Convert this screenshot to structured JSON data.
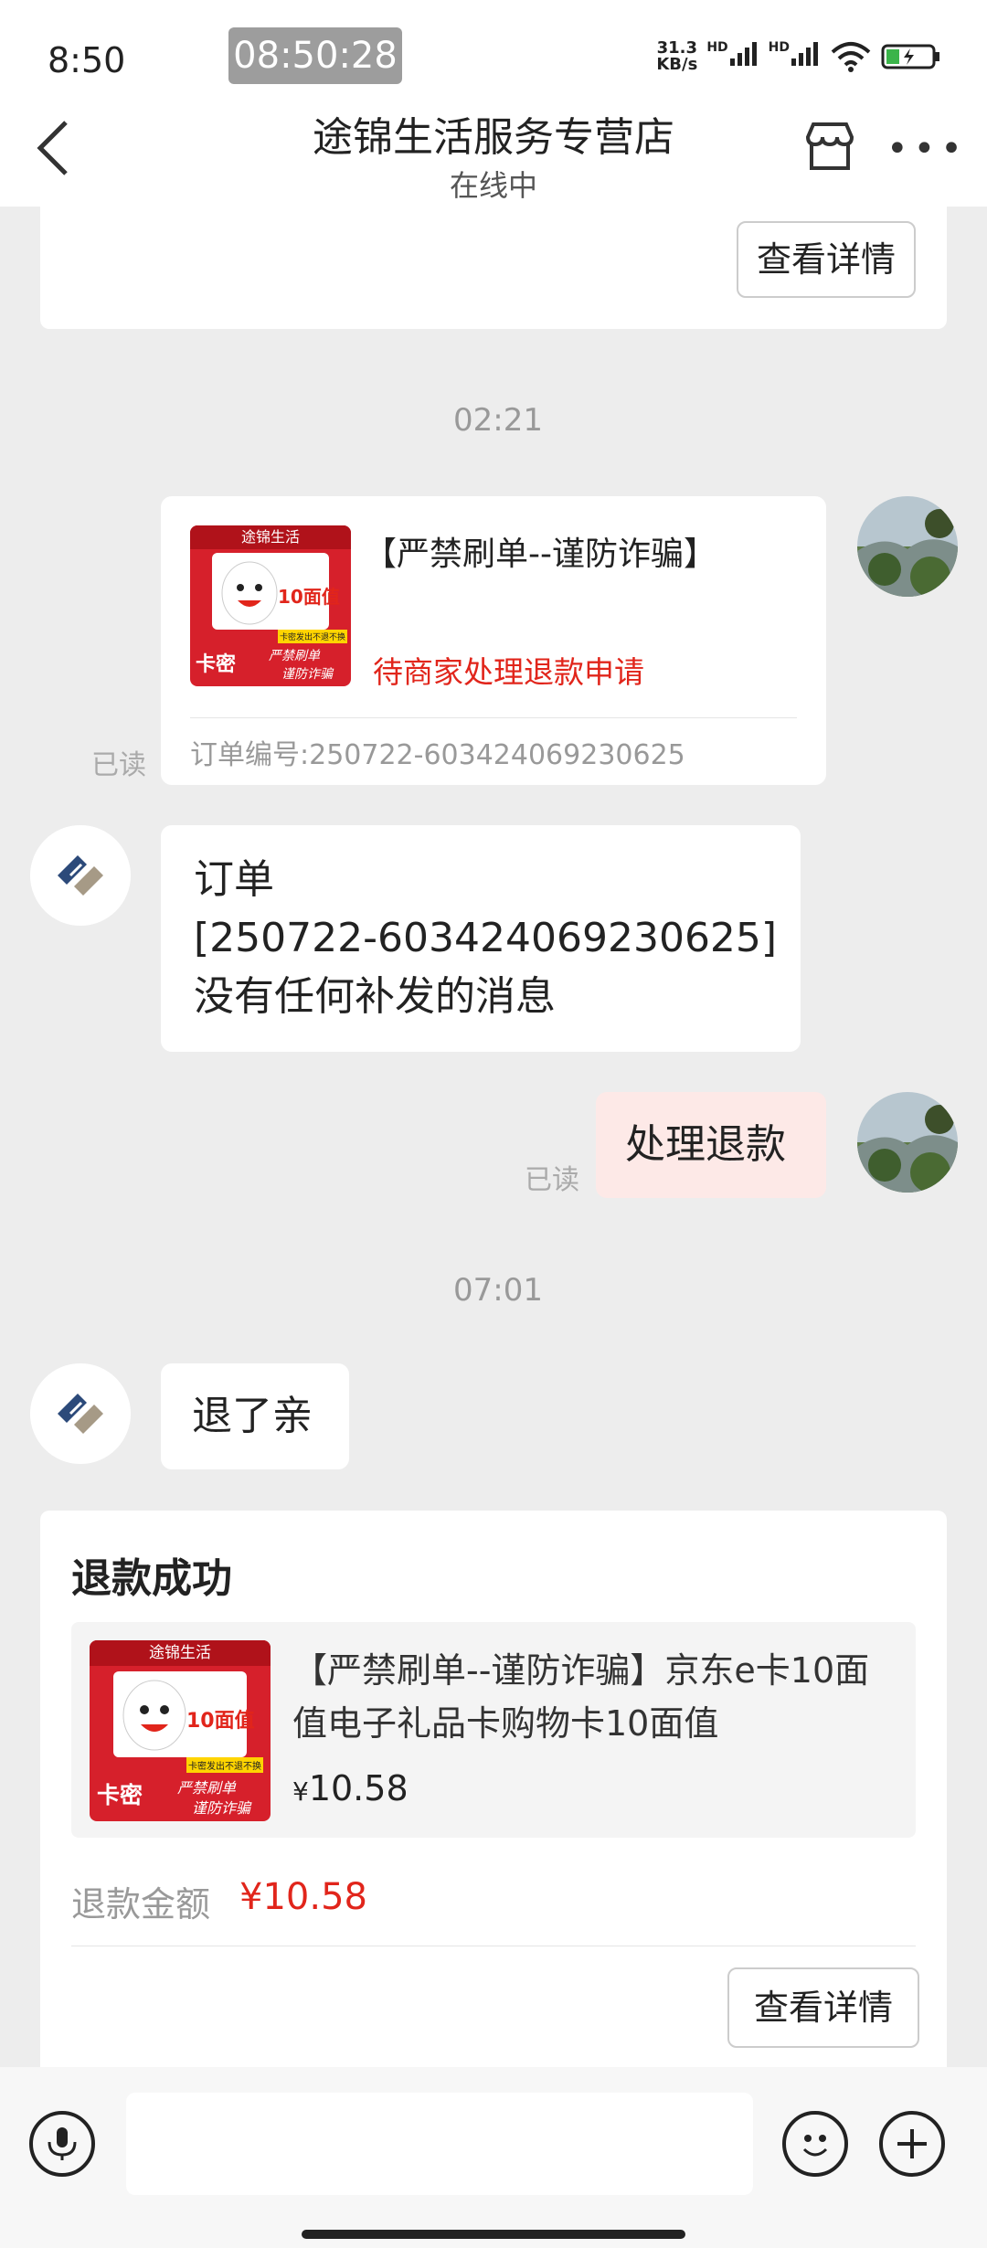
{
  "status": {
    "time": "8:50",
    "overlay_time": "08:50:28",
    "netspeed_top": "31.3",
    "netspeed_bottom": "KB/s",
    "hd1": "HD",
    "hd2": "HD"
  },
  "header": {
    "title": "途锦生活服务专营店",
    "subtitle": "在线中"
  },
  "top_card": {
    "details_button": "查看详情"
  },
  "messages": {
    "ts1": "02:21",
    "order_card": {
      "title": "【严禁刷单--谨防诈骗】",
      "status": "待商家处理退款申请",
      "order_no": "订单编号:250722-603424069230625",
      "read": "已读"
    },
    "shop_msg1": {
      "line1": "订单",
      "line2": "[250722-603424069230625]",
      "line3": "没有任何补发的消息"
    },
    "my_msg": {
      "text": "处理退款",
      "read": "已读"
    },
    "ts2": "07:01",
    "shop_msg2": {
      "text": "退了亲"
    }
  },
  "product_image": {
    "banner": "途锦生活",
    "face_value": "10面值",
    "note": "卡密发出不退不换",
    "kami": "卡密",
    "warn1": "严禁刷单",
    "warn2": "谨防诈骗"
  },
  "refund_card": {
    "title": "退款成功",
    "product_name": "【严禁刷单--谨防诈骗】京东e卡10面值电子礼品卡购物卡10面值",
    "price_symbol": "¥",
    "price": "10.58",
    "amount_label": "退款金额",
    "amount_value": "¥10.58",
    "details_button": "查看详情"
  },
  "colors": {
    "accent_red": "#e1251b",
    "bubble_me": "#fde9e7"
  }
}
